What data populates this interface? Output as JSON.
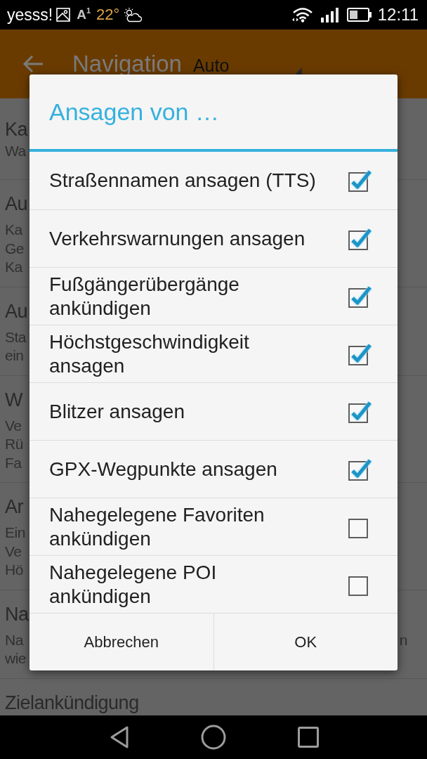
{
  "status_bar": {
    "carrier": "yesss!",
    "notification_label": "A$^{1}$",
    "temperature": "22°",
    "time": "12:11"
  },
  "app_bar": {
    "title": "Navigation",
    "spinner_value": "Auto"
  },
  "settings_list": [
    {
      "title": "Ka",
      "summary_lines": [
        {
          "left": "Wa"
        }
      ]
    },
    {
      "title": "Au",
      "summary_lines": [
        {
          "left": "Ka"
        },
        {
          "left": "Ge"
        },
        {
          "left": "Ka"
        }
      ]
    },
    {
      "title": "Au",
      "summary_lines": [
        {
          "left": "Sta"
        },
        {
          "left": "ein"
        }
      ]
    },
    {
      "title": "W",
      "summary_lines": [
        {
          "left": "Ve"
        },
        {
          "left": "Rü"
        },
        {
          "left": "Fa"
        }
      ]
    },
    {
      "title": "Ar",
      "summary_lines": [
        {
          "left": "Ein"
        },
        {
          "left": "Ve"
        },
        {
          "left": "Hö"
        }
      ]
    },
    {
      "title": "Na",
      "summary_lines": [
        {
          "left": "Na",
          "right": "n"
        },
        {
          "left": "wie"
        }
      ]
    },
    {
      "title": "Zielankündigung"
    }
  ],
  "dialog": {
    "title": "Ansagen von …",
    "options": [
      {
        "label": "Straßennamen ansagen (TTS)",
        "checked": true
      },
      {
        "label": "Verkehrswarnungen ansagen",
        "checked": true
      },
      {
        "label": "Fußgängerübergänge ankündigen",
        "checked": true
      },
      {
        "label": "Höchstgeschwindigkeit ansagen",
        "checked": true
      },
      {
        "label": "Blitzer ansagen",
        "checked": true
      },
      {
        "label": "GPX-Wegpunkte ansagen",
        "checked": true
      },
      {
        "label": "Nahegelegene Favoriten ankündigen",
        "checked": false
      },
      {
        "label": "Nahegelegene POI ankündigen",
        "checked": false
      }
    ],
    "buttons": [
      {
        "label": "Abbrechen"
      },
      {
        "label": "OK"
      }
    ]
  }
}
